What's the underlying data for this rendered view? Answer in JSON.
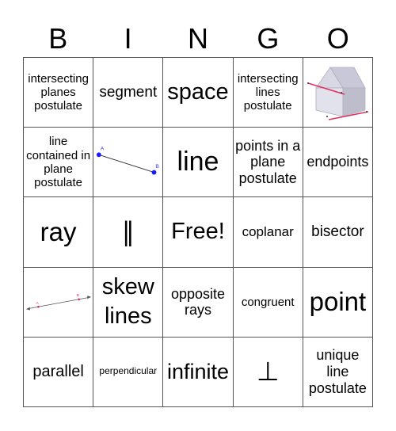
{
  "header": {
    "letters": [
      "B",
      "I",
      "N",
      "G",
      "O"
    ]
  },
  "cells": [
    {
      "type": "text",
      "text": "intersecting planes postulate"
    },
    {
      "type": "text",
      "text": "segment"
    },
    {
      "type": "text",
      "text": "space"
    },
    {
      "type": "text",
      "text": "intersecting lines postulate"
    },
    {
      "type": "image",
      "icon": "house-plane-diagram-icon"
    },
    {
      "type": "text",
      "text": "line contained in plane postulate"
    },
    {
      "type": "image",
      "icon": "segment-ab-diagram-icon",
      "labels": [
        "A",
        "B"
      ]
    },
    {
      "type": "text",
      "text": "line"
    },
    {
      "type": "text",
      "text": "points in a plane postulate"
    },
    {
      "type": "text",
      "text": "endpoints"
    },
    {
      "type": "text",
      "text": "ray"
    },
    {
      "type": "text",
      "text": "∥"
    },
    {
      "type": "text",
      "text": "Free!"
    },
    {
      "type": "text",
      "text": "coplanar"
    },
    {
      "type": "text",
      "text": "bisector"
    },
    {
      "type": "image",
      "icon": "line-ab-diagram-icon",
      "labels": [
        "A",
        "B"
      ]
    },
    {
      "type": "text",
      "text": "skew lines"
    },
    {
      "type": "text",
      "text": "opposite rays"
    },
    {
      "type": "text",
      "text": "congruent"
    },
    {
      "type": "text",
      "text": "point"
    },
    {
      "type": "text",
      "text": "parallel"
    },
    {
      "type": "text",
      "text": "perpendicular"
    },
    {
      "type": "text",
      "text": "infinite"
    },
    {
      "type": "text",
      "text": "⊥"
    },
    {
      "type": "text",
      "text": "unique line postulate"
    }
  ],
  "colors": {
    "point_blue": "#1a1aff",
    "diagram_red": "#e03060",
    "grid_line": "#555555"
  }
}
